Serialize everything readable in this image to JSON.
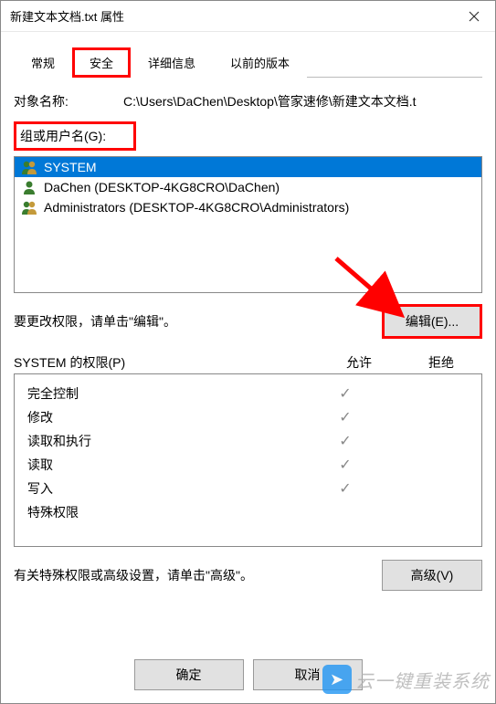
{
  "window": {
    "title": "新建文本文档.txt 属性"
  },
  "tabs": {
    "general": "常规",
    "security": "安全",
    "details": "详细信息",
    "previous": "以前的版本",
    "active": "security"
  },
  "object": {
    "label": "对象名称:",
    "path": "C:\\Users\\DaChen\\Desktop\\管家速修\\新建文本文档.t"
  },
  "group_label": "组或用户名(G):",
  "users": [
    {
      "name": "SYSTEM",
      "selected": true,
      "iconColors": [
        "#3a7d2f",
        "#c49a3a"
      ]
    },
    {
      "name": "DaChen (DESKTOP-4KG8CRO\\DaChen)",
      "selected": false,
      "iconColors": [
        "#3a7d2f"
      ]
    },
    {
      "name": "Administrators (DESKTOP-4KG8CRO\\Administrators)",
      "selected": false,
      "iconColors": [
        "#3a7d2f",
        "#c49a3a"
      ]
    }
  ],
  "edit_row": {
    "text": "要更改权限，请单击\"编辑\"。",
    "button": "编辑(E)..."
  },
  "perm_header": {
    "title_prefix": "SYSTEM 的权限(P)",
    "allow": "允许",
    "deny": "拒绝"
  },
  "permissions": [
    {
      "name": "完全控制",
      "allow": true,
      "deny": false
    },
    {
      "name": "修改",
      "allow": true,
      "deny": false
    },
    {
      "name": "读取和执行",
      "allow": true,
      "deny": false
    },
    {
      "name": "读取",
      "allow": true,
      "deny": false
    },
    {
      "name": "写入",
      "allow": true,
      "deny": false
    },
    {
      "name": "特殊权限",
      "allow": false,
      "deny": false
    }
  ],
  "advanced": {
    "text": "有关特殊权限或高级设置，请单击\"高级\"。",
    "button": "高级(V)"
  },
  "footer": {
    "ok": "确定",
    "cancel": "取消"
  },
  "watermark": {
    "text": "云一键重装系统"
  }
}
